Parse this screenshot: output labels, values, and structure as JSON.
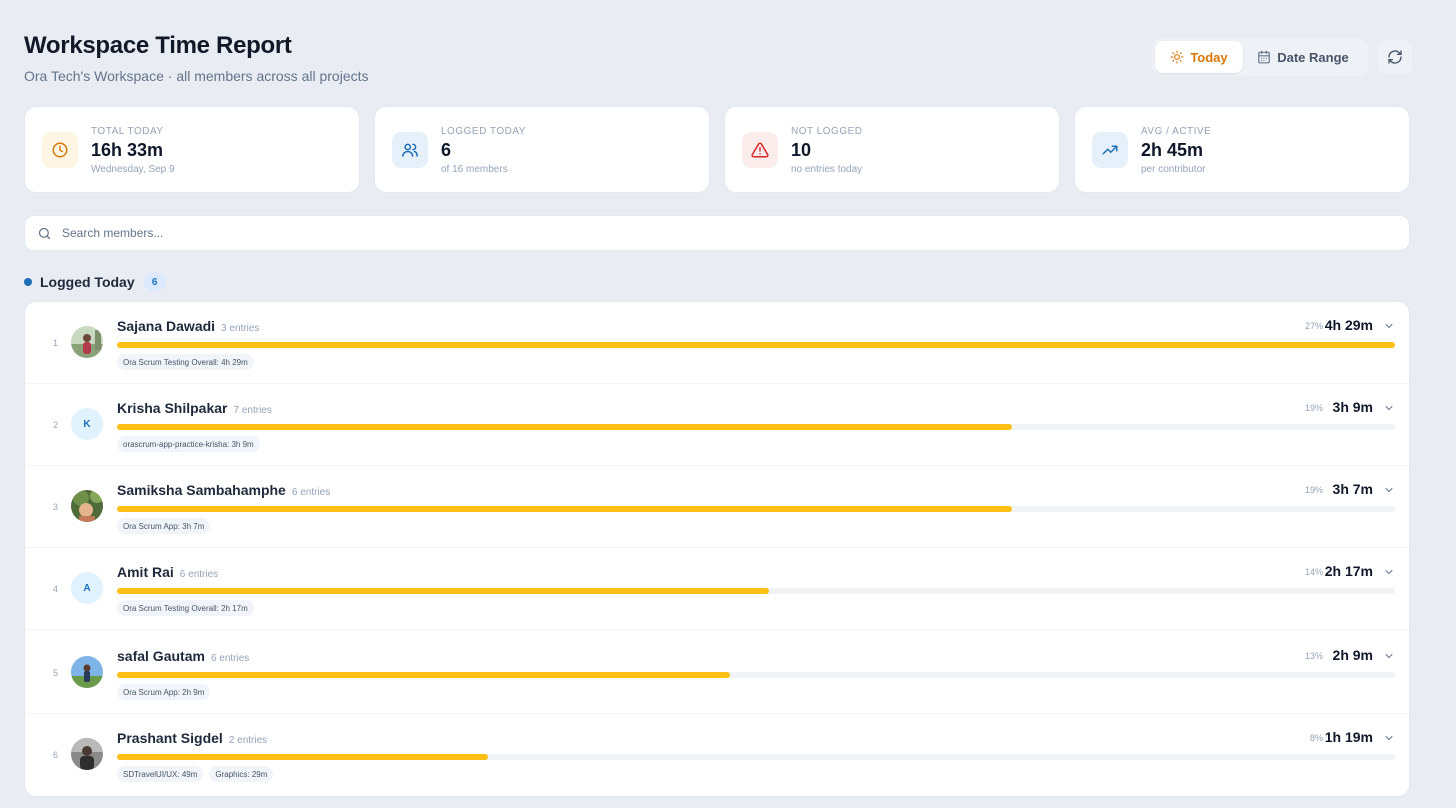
{
  "header": {
    "title": "Workspace Time Report",
    "subtitle": "Ora Tech's Workspace · all members across all projects"
  },
  "toggle": {
    "today_label": "Today",
    "range_label": "Date Range",
    "selected": "Today"
  },
  "accent": "#d97706",
  "stats": [
    {
      "label": "TOTAL TODAY",
      "value": "16h 33m",
      "sub": "Wednesday, Sep 9",
      "icon": "clock-icon",
      "color": "#d97706"
    },
    {
      "label": "LOGGED TODAY",
      "value": "6",
      "sub": "of 16 members",
      "icon": "users-icon",
      "color": "#1d6fb8"
    },
    {
      "label": "NOT LOGGED",
      "value": "10",
      "sub": "no entries today",
      "icon": "alert-triangle-icon",
      "color": "#dc2626"
    },
    {
      "label": "AVG / ACTIVE",
      "value": "2h 45m",
      "sub": "per contributor",
      "icon": "trending-up-icon",
      "color": "#1d6fb8"
    }
  ],
  "search": {
    "placeholder": "Search members..."
  },
  "section": {
    "title": "Logged Today",
    "count": "6"
  },
  "members": [
    {
      "rank": "1",
      "name": "Sajana Dawadi",
      "entries": "3 entries",
      "percent": "27%",
      "duration": "4h 29m",
      "progress": 1.0,
      "avatar": "photo",
      "projects": [
        "Ora Scrum Testing Overall: 4h 29m"
      ]
    },
    {
      "rank": "2",
      "name": "Krisha Shilpakar",
      "entries": "7 entries",
      "percent": "19%",
      "duration": "3h 9m",
      "progress": 0.7,
      "avatar": "K",
      "projects": [
        "orascrum-app-practice-krisha: 3h 9m"
      ]
    },
    {
      "rank": "3",
      "name": "Samiksha Sambahamphe",
      "entries": "6 entries",
      "percent": "19%",
      "duration": "3h 7m",
      "progress": 0.7,
      "avatar": "photo",
      "projects": [
        "Ora Scrum App: 3h 7m"
      ]
    },
    {
      "rank": "4",
      "name": "Amit Rai",
      "entries": "6 entries",
      "percent": "14%",
      "duration": "2h 17m",
      "progress": 0.51,
      "avatar": "A",
      "projects": [
        "Ora Scrum Testing Overall: 2h 17m"
      ]
    },
    {
      "rank": "5",
      "name": "safal Gautam",
      "entries": "6 entries",
      "percent": "13%",
      "duration": "2h 9m",
      "progress": 0.48,
      "avatar": "photo",
      "projects": [
        "Ora Scrum App: 2h 9m"
      ]
    },
    {
      "rank": "6",
      "name": "Prashant Sigdel",
      "entries": "2 entries",
      "percent": "8%",
      "duration": "1h 19m",
      "progress": 0.29,
      "avatar": "photo",
      "projects": [
        "SDTravelUI/UX: 49m",
        "Graphics: 29m"
      ]
    }
  ]
}
